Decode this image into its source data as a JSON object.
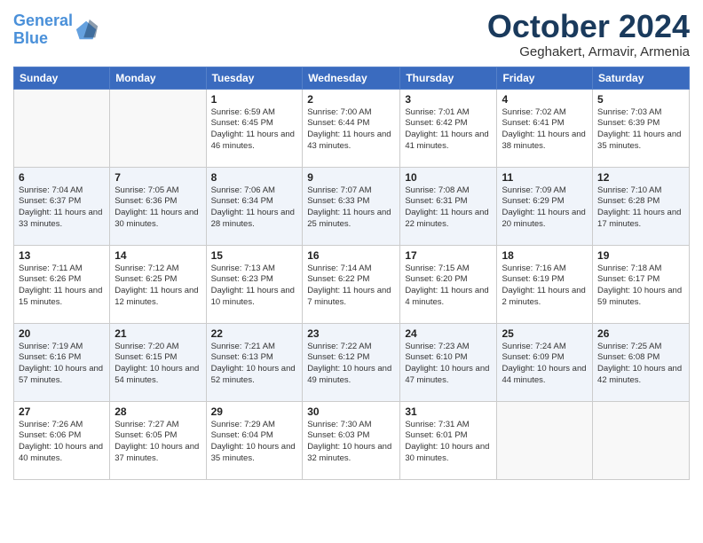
{
  "header": {
    "logo_line1": "General",
    "logo_line2": "Blue",
    "month_year": "October 2024",
    "location": "Geghakert, Armavir, Armenia"
  },
  "days_of_week": [
    "Sunday",
    "Monday",
    "Tuesday",
    "Wednesday",
    "Thursday",
    "Friday",
    "Saturday"
  ],
  "weeks": [
    [
      {
        "day": "",
        "text": ""
      },
      {
        "day": "",
        "text": ""
      },
      {
        "day": "1",
        "text": "Sunrise: 6:59 AM\nSunset: 6:45 PM\nDaylight: 11 hours and 46 minutes."
      },
      {
        "day": "2",
        "text": "Sunrise: 7:00 AM\nSunset: 6:44 PM\nDaylight: 11 hours and 43 minutes."
      },
      {
        "day": "3",
        "text": "Sunrise: 7:01 AM\nSunset: 6:42 PM\nDaylight: 11 hours and 41 minutes."
      },
      {
        "day": "4",
        "text": "Sunrise: 7:02 AM\nSunset: 6:41 PM\nDaylight: 11 hours and 38 minutes."
      },
      {
        "day": "5",
        "text": "Sunrise: 7:03 AM\nSunset: 6:39 PM\nDaylight: 11 hours and 35 minutes."
      }
    ],
    [
      {
        "day": "6",
        "text": "Sunrise: 7:04 AM\nSunset: 6:37 PM\nDaylight: 11 hours and 33 minutes."
      },
      {
        "day": "7",
        "text": "Sunrise: 7:05 AM\nSunset: 6:36 PM\nDaylight: 11 hours and 30 minutes."
      },
      {
        "day": "8",
        "text": "Sunrise: 7:06 AM\nSunset: 6:34 PM\nDaylight: 11 hours and 28 minutes."
      },
      {
        "day": "9",
        "text": "Sunrise: 7:07 AM\nSunset: 6:33 PM\nDaylight: 11 hours and 25 minutes."
      },
      {
        "day": "10",
        "text": "Sunrise: 7:08 AM\nSunset: 6:31 PM\nDaylight: 11 hours and 22 minutes."
      },
      {
        "day": "11",
        "text": "Sunrise: 7:09 AM\nSunset: 6:29 PM\nDaylight: 11 hours and 20 minutes."
      },
      {
        "day": "12",
        "text": "Sunrise: 7:10 AM\nSunset: 6:28 PM\nDaylight: 11 hours and 17 minutes."
      }
    ],
    [
      {
        "day": "13",
        "text": "Sunrise: 7:11 AM\nSunset: 6:26 PM\nDaylight: 11 hours and 15 minutes."
      },
      {
        "day": "14",
        "text": "Sunrise: 7:12 AM\nSunset: 6:25 PM\nDaylight: 11 hours and 12 minutes."
      },
      {
        "day": "15",
        "text": "Sunrise: 7:13 AM\nSunset: 6:23 PM\nDaylight: 11 hours and 10 minutes."
      },
      {
        "day": "16",
        "text": "Sunrise: 7:14 AM\nSunset: 6:22 PM\nDaylight: 11 hours and 7 minutes."
      },
      {
        "day": "17",
        "text": "Sunrise: 7:15 AM\nSunset: 6:20 PM\nDaylight: 11 hours and 4 minutes."
      },
      {
        "day": "18",
        "text": "Sunrise: 7:16 AM\nSunset: 6:19 PM\nDaylight: 11 hours and 2 minutes."
      },
      {
        "day": "19",
        "text": "Sunrise: 7:18 AM\nSunset: 6:17 PM\nDaylight: 10 hours and 59 minutes."
      }
    ],
    [
      {
        "day": "20",
        "text": "Sunrise: 7:19 AM\nSunset: 6:16 PM\nDaylight: 10 hours and 57 minutes."
      },
      {
        "day": "21",
        "text": "Sunrise: 7:20 AM\nSunset: 6:15 PM\nDaylight: 10 hours and 54 minutes."
      },
      {
        "day": "22",
        "text": "Sunrise: 7:21 AM\nSunset: 6:13 PM\nDaylight: 10 hours and 52 minutes."
      },
      {
        "day": "23",
        "text": "Sunrise: 7:22 AM\nSunset: 6:12 PM\nDaylight: 10 hours and 49 minutes."
      },
      {
        "day": "24",
        "text": "Sunrise: 7:23 AM\nSunset: 6:10 PM\nDaylight: 10 hours and 47 minutes."
      },
      {
        "day": "25",
        "text": "Sunrise: 7:24 AM\nSunset: 6:09 PM\nDaylight: 10 hours and 44 minutes."
      },
      {
        "day": "26",
        "text": "Sunrise: 7:25 AM\nSunset: 6:08 PM\nDaylight: 10 hours and 42 minutes."
      }
    ],
    [
      {
        "day": "27",
        "text": "Sunrise: 7:26 AM\nSunset: 6:06 PM\nDaylight: 10 hours and 40 minutes."
      },
      {
        "day": "28",
        "text": "Sunrise: 7:27 AM\nSunset: 6:05 PM\nDaylight: 10 hours and 37 minutes."
      },
      {
        "day": "29",
        "text": "Sunrise: 7:29 AM\nSunset: 6:04 PM\nDaylight: 10 hours and 35 minutes."
      },
      {
        "day": "30",
        "text": "Sunrise: 7:30 AM\nSunset: 6:03 PM\nDaylight: 10 hours and 32 minutes."
      },
      {
        "day": "31",
        "text": "Sunrise: 7:31 AM\nSunset: 6:01 PM\nDaylight: 10 hours and 30 minutes."
      },
      {
        "day": "",
        "text": ""
      },
      {
        "day": "",
        "text": ""
      }
    ]
  ]
}
